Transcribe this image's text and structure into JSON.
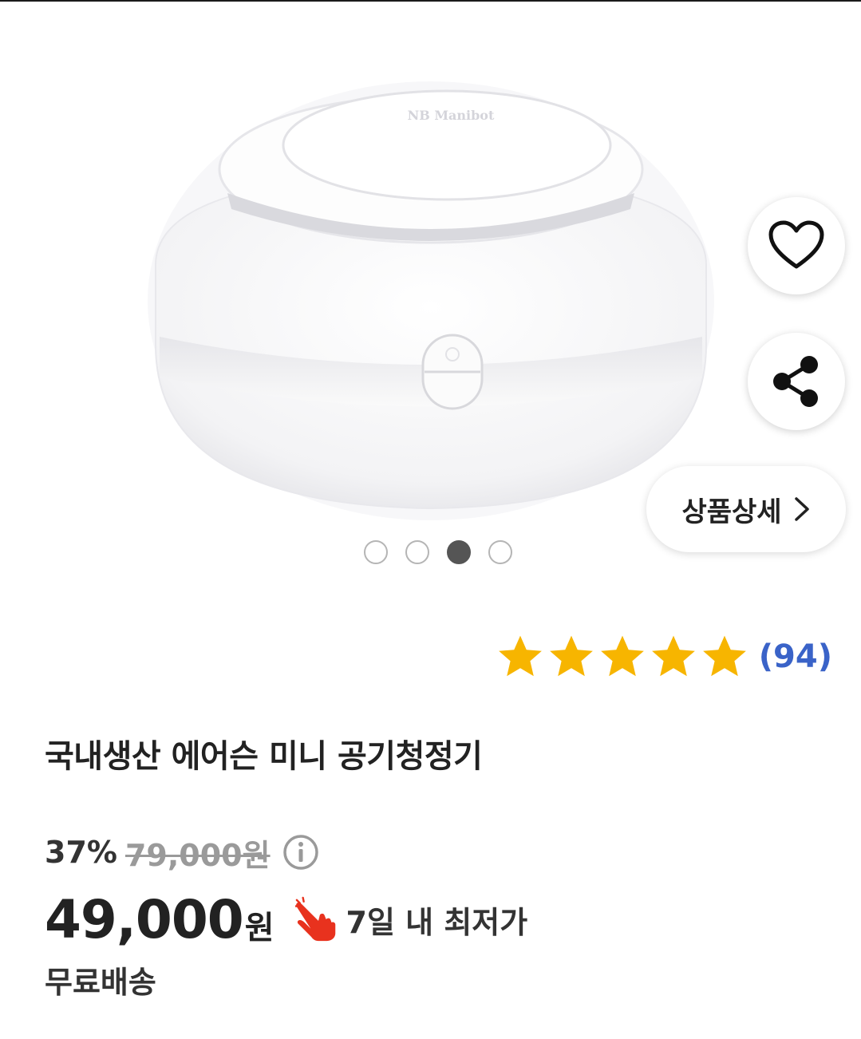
{
  "gallery": {
    "brand_mark": "NB Manibot",
    "total_images": 4,
    "active_index": 2,
    "like_icon": "heart-outline-icon",
    "share_icon": "share-icon",
    "detail_label": "상품상세",
    "detail_icon": "chevron-right-icon"
  },
  "rating": {
    "stars": 5,
    "star_color": "#f7b500",
    "review_count": "(94)",
    "count_color": "#3a63c8"
  },
  "product": {
    "title": "국내생산 에어슨 미니 공기청정기"
  },
  "pricing": {
    "discount_rate": "37%",
    "original_price": "79,000원",
    "info_icon": "info-circle-icon",
    "price": "49,000",
    "price_unit": "원",
    "hand_icon": "pointing-hand-icon",
    "lowest_label": "7일 내 최저가",
    "shipping": "무료배송"
  }
}
